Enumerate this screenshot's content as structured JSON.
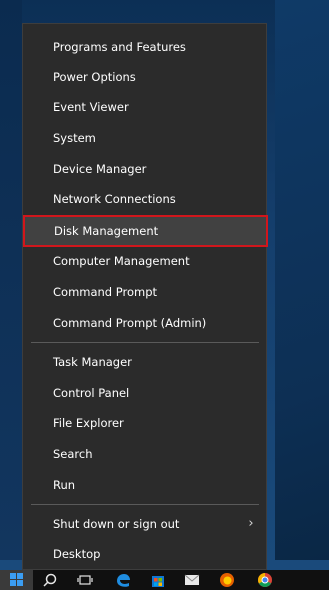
{
  "menu": {
    "items": [
      {
        "label": "Programs and Features"
      },
      {
        "label": "Power Options"
      },
      {
        "label": "Event Viewer"
      },
      {
        "label": "System"
      },
      {
        "label": "Device Manager"
      },
      {
        "label": "Network Connections"
      },
      {
        "label": "Disk Management"
      },
      {
        "label": "Computer Management"
      },
      {
        "label": "Command Prompt"
      },
      {
        "label": "Command Prompt (Admin)"
      },
      {
        "label": "Task Manager"
      },
      {
        "label": "Control Panel"
      },
      {
        "label": "File Explorer"
      },
      {
        "label": "Search"
      },
      {
        "label": "Run"
      },
      {
        "label": "Shut down or sign out"
      },
      {
        "label": "Desktop"
      }
    ],
    "highlighted": "Disk Management",
    "submenu_arrow": "›"
  },
  "taskbar": {
    "icons": [
      "windows-start-icon",
      "search-icon",
      "task-view-icon",
      "edge-icon",
      "store-icon",
      "mail-icon",
      "firefox-icon",
      "chrome-icon"
    ]
  },
  "colors": {
    "menu_bg": "#2b2b2b",
    "highlight_bg": "#414141",
    "highlight_outline": "#d1161c",
    "text": "#ffffff",
    "taskbar_bg": "#101010",
    "windows_blue": "#3b9df2"
  }
}
